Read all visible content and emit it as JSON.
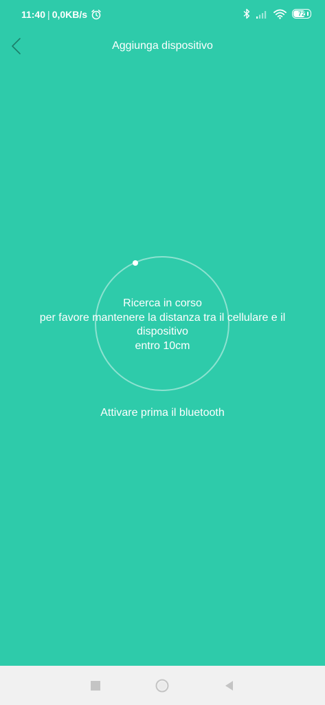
{
  "status_bar": {
    "time": "11:40",
    "separator": "|",
    "net_speed": "0,0KB/s",
    "battery_level": "72",
    "battery_fraction": 0.72,
    "icons": [
      "alarm-icon",
      "bluetooth-icon",
      "signal-icon",
      "wifi-icon",
      "battery-icon"
    ]
  },
  "header": {
    "title": "Aggiunga dispositivo",
    "back_icon": "chevron-left-icon"
  },
  "scan": {
    "lines": [
      "Ricerca in corso",
      "per favore mantenere la distanza tra il cellulare e il",
      "dispositivo",
      "entro 10cm"
    ],
    "bluetooth_hint": "Attivare prima il bluetooth"
  },
  "nav_bar": {
    "buttons": [
      "recent-apps-icon",
      "home-icon",
      "back-triangle-icon"
    ]
  },
  "colors": {
    "background": "#2ecbaa",
    "text": "#ffffff",
    "nav_background": "#f1f1f1",
    "nav_icon": "#c4c4c4"
  }
}
